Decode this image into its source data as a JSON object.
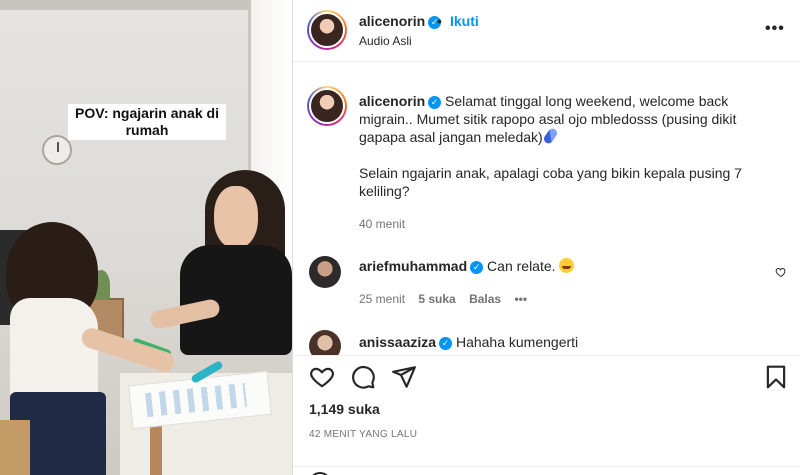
{
  "media": {
    "caption_overlay": "POV: ngajarin anak di rumah"
  },
  "header": {
    "username": "alicenorin",
    "separator": "•",
    "follow_label": "Ikuti",
    "audio": "Audio Asli",
    "more_label": "•••"
  },
  "caption": {
    "username": "alicenorin",
    "text1": "Selamat tinggal long weekend, welcome back migrain.. Mumet sitik rapopo asal ojo mbledosss (pusing dikit gapapa asal jangan meledak)",
    "text2": "Selain ngajarin anak, apalagi coba yang bikin kepala pusing 7 keliling?",
    "time": "40 menit"
  },
  "comments": [
    {
      "username": "ariefmuhammad",
      "text": "Can relate.",
      "time": "25 menit",
      "likes": "5 suka",
      "reply": "Balas",
      "more": "•••"
    },
    {
      "username": "anissaaziza",
      "text": "Hahaha kumengerti"
    }
  ],
  "actions": {
    "likes": "1,149 suka",
    "posted": "42 MENIT YANG LALU"
  },
  "icons": {
    "verified": "verified-badge-icon",
    "like": "heart-icon",
    "comment": "comment-bubble-icon",
    "share": "paper-plane-icon",
    "save": "bookmark-icon",
    "more": "more-dots-icon"
  },
  "colors": {
    "accent": "#0095f6",
    "text": "#262626",
    "secondary": "#737373"
  }
}
